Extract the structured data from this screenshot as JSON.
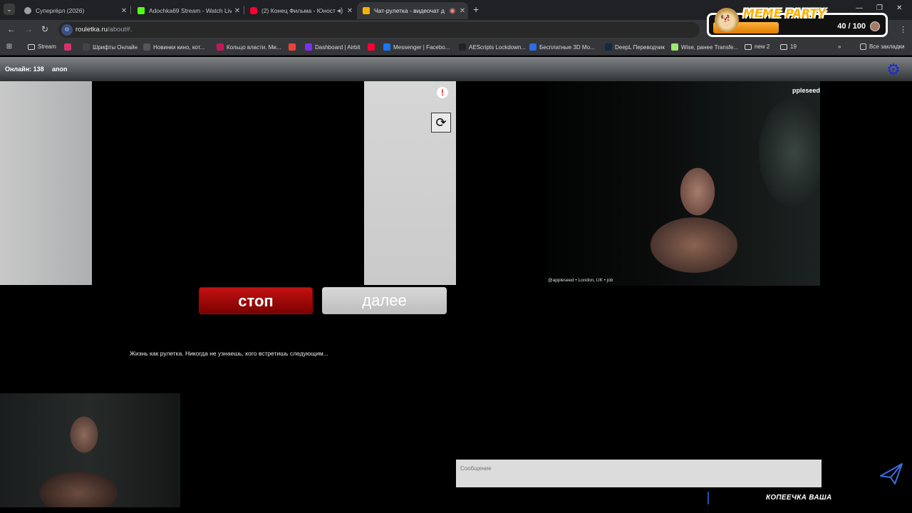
{
  "browser": {
    "tabs": [
      {
        "title": "Суперrёрл (2026)",
        "favicon_color": "#9aa0a6"
      },
      {
        "title": "Adochka69 Stream - Watch Live",
        "favicon_color": "#53fc18"
      },
      {
        "title": "(2) Конец Фильма - Юность",
        "favicon_color": "#ff0033"
      },
      {
        "title": "Чат-рулетка - видеочат д",
        "favicon_color": "#f5b400"
      }
    ],
    "new_tab": "+",
    "url_host": "rouletka.ru",
    "url_path": "/about#."
  },
  "bookmarks": [
    {
      "label": "Stream",
      "icon": "folder-icon",
      "color": "#dcdcdc"
    },
    {
      "label": "",
      "icon": "live-icon",
      "color": "#d6336c"
    },
    {
      "label": "Шрифты Онлайн",
      "icon": "font-icon",
      "color": "#444"
    },
    {
      "label": "Новинки кино, кот...",
      "icon": "film-icon",
      "color": "#555"
    },
    {
      "label": "Кольцо власти. Ми...",
      "icon": "r-icon",
      "color": "#c2185b"
    },
    {
      "label": "",
      "icon": "gmail-icon",
      "color": "#ea4335"
    },
    {
      "label": "Dashboard | Airbit",
      "icon": "airbit-icon",
      "color": "#7b2ff7"
    },
    {
      "label": "Messenger | Facebo...",
      "icon": "facebook-icon",
      "color": "#1877f2"
    },
    {
      "label": "",
      "icon": "youtube-icon",
      "color": "#ff0033"
    },
    {
      "label": "AEScripts Lockdown...",
      "icon": "aescripts-icon",
      "color": "#222"
    },
    {
      "label": "Бесплатные 3D Мо...",
      "icon": "3d-icon",
      "color": "#2d6cdf"
    },
    {
      "label": "DeepL Переводчик",
      "icon": "deepl-icon",
      "color": "#0f2b46"
    },
    {
      "label": "Wise, ранее Transfe...",
      "icon": "wise-icon",
      "color": "#9fe870"
    },
    {
      "label": "new 2",
      "icon": "folder-icon",
      "color": "#dcdcdc"
    },
    {
      "label": "19",
      "icon": "folder-icon",
      "color": "#dcdcdc"
    }
  ],
  "bookmarks_more": "»",
  "all_bookmarks": "Все закладки",
  "overlay": {
    "title": "MEME PARTY",
    "score": "40 / 100",
    "progress": 0.4
  },
  "site": {
    "online_label": "Онлайн: 138",
    "user_name": "anon",
    "report": "!",
    "rotate": "⟳",
    "self_nick": "ppleseed",
    "self_caption": "@appleseed • London, UK • job",
    "stop_button": "стоп",
    "next_button": "далее",
    "tagline": "Жизнь как рулетка. Никогда не узнаешь, кого встретишь следующим...",
    "message_placeholder": "Сообщение",
    "brand_text": "КОПЕЕЧКА ВАША"
  },
  "colors": {
    "stop": "#b00000",
    "next": "#c9c9c9",
    "settings": "#1a2bd8"
  }
}
